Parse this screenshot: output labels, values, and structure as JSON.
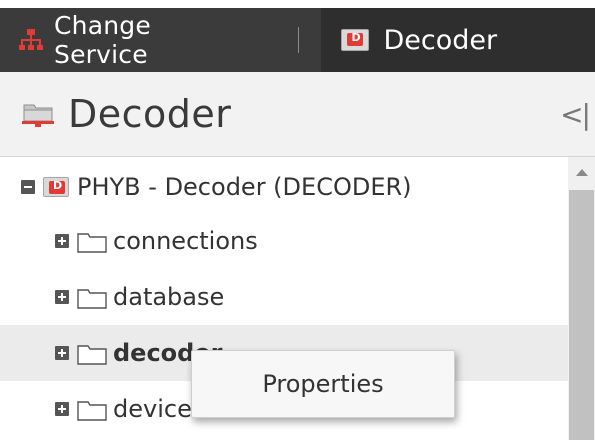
{
  "toolbar": {
    "change_service_label": "Change Service",
    "active_service_label": "Decoder",
    "service_badge_letter": "D"
  },
  "panel": {
    "title": "Decoder",
    "collapse_glyph": "<|"
  },
  "tree": {
    "root": {
      "label": "PHYB - Decoder (DECODER)",
      "badge_letter": "D",
      "expanded": true
    },
    "children": [
      {
        "label": "connections",
        "selected": false
      },
      {
        "label": "database",
        "selected": false
      },
      {
        "label": "decoder",
        "selected": true
      },
      {
        "label": "device",
        "selected": false
      }
    ]
  },
  "context_menu": {
    "items": [
      "Properties"
    ]
  },
  "icons": {
    "change_service": "network-icon",
    "service": "decoder-device-icon",
    "panel": "folder-red-icon",
    "tree_folder": "folder-icon",
    "expander_expanded": "minus-box-icon",
    "expander_collapsed": "plus-box-icon"
  },
  "colors": {
    "toolbar_bg": "#3b3b3b",
    "accent_red": "#e23a35",
    "selected_row": "#ebebeb"
  }
}
